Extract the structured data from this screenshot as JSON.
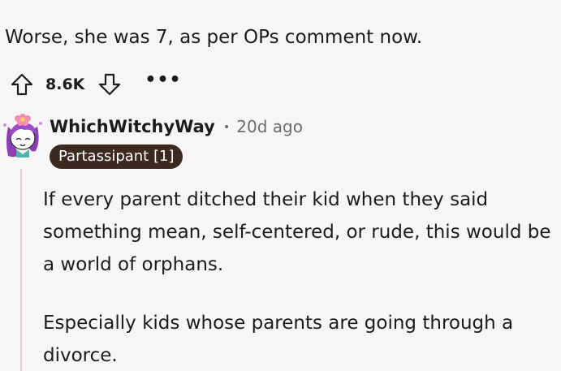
{
  "previous_comment": {
    "text": "Worse, she was 7, as per OPs comment now.",
    "vote_count": "8.6K",
    "icons": {
      "upvote": "arrow-up-icon",
      "downvote": "arrow-down-icon",
      "more": "ellipsis-icon"
    },
    "more_label": "•••"
  },
  "comment": {
    "username": "WhichWitchyWay",
    "separator": "•",
    "age": "20d ago",
    "flair": "Partassipant [1]",
    "avatar_icon": "witch-avatar-icon",
    "paragraphs": [
      "If every parent ditched their kid when they said something mean, self-centered, or rude, this would be a world of orphans.",
      "Especially kids whose parents are going through a divorce."
    ]
  },
  "colors": {
    "background": "#f8f6f4",
    "flair_bg": "#3b2a1f",
    "meta_text": "#6a6d70",
    "avatar_hair": "#8b3fb5",
    "avatar_flower": "#f48fb1"
  }
}
